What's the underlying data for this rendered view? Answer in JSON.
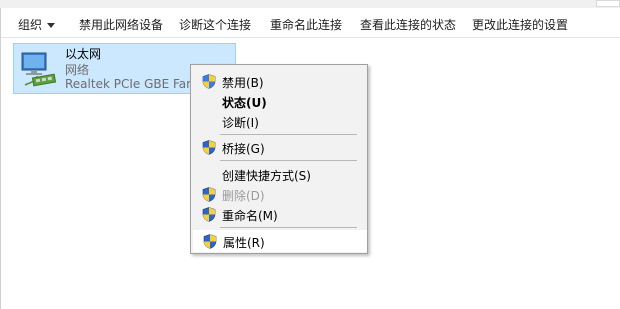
{
  "toolbar": {
    "organize": "组织",
    "disable": "禁用此网络设备",
    "diagnose": "诊断这个连接",
    "rename": "重命名此连接",
    "status": "查看此连接的状态",
    "settings": "更改此连接的设置"
  },
  "adapter": {
    "name": "以太网",
    "type": "网络",
    "device": "Realtek PCIe GBE Family"
  },
  "menu": {
    "disable": "禁用(B)",
    "status": "状态(U)",
    "diagnose": "诊断(I)",
    "bridge": "桥接(G)",
    "shortcut": "创建快捷方式(S)",
    "delete": "删除(D)",
    "rename": "重命名(M)",
    "properties": "属性(R)"
  },
  "colors": {
    "selection_bg": "#cce8ff",
    "selection_border": "#99d1ff",
    "menu_bg": "#f2f2f2"
  }
}
